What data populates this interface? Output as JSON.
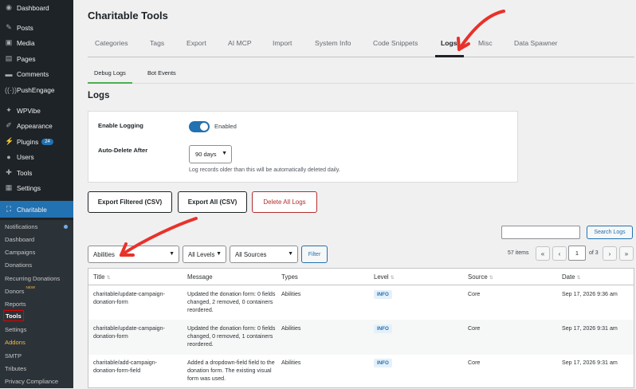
{
  "sidebar": {
    "menu": [
      {
        "label": "Dashboard",
        "icon": "dashboard-icon"
      },
      {
        "label": "Posts",
        "icon": "pin-icon"
      },
      {
        "label": "Media",
        "icon": "media-icon"
      },
      {
        "label": "Pages",
        "icon": "page-icon"
      },
      {
        "label": "Comments",
        "icon": "comment-icon"
      },
      {
        "label": "PushEngage",
        "icon": "broadcast-icon"
      },
      {
        "label": "WPVibe",
        "icon": "sparkle-icon"
      },
      {
        "label": "Appearance",
        "icon": "brush-icon"
      },
      {
        "label": "Plugins",
        "icon": "plug-icon",
        "badge": "24"
      },
      {
        "label": "Users",
        "icon": "user-icon"
      },
      {
        "label": "Tools",
        "icon": "wrench-icon"
      },
      {
        "label": "Settings",
        "icon": "settings-icon"
      },
      {
        "label": "Charitable",
        "icon": "charitable-icon"
      }
    ],
    "submenu": [
      {
        "label": "Notifications"
      },
      {
        "label": "Dashboard"
      },
      {
        "label": "Campaigns"
      },
      {
        "label": "Donations"
      },
      {
        "label": "Recurring Donations"
      },
      {
        "label": "Donors",
        "tag": "NEW!"
      },
      {
        "label": "Reports"
      },
      {
        "label": "Tools"
      },
      {
        "label": "Settings"
      },
      {
        "label": "Addons"
      },
      {
        "label": "SMTP"
      },
      {
        "label": "Tributes"
      },
      {
        "label": "Privacy Compliance"
      }
    ]
  },
  "page": {
    "title": "Charitable Tools",
    "tabs": [
      "Categories",
      "Tags",
      "Export",
      "AI MCP",
      "Import",
      "System Info",
      "Code Snippets",
      "Logs",
      "Misc",
      "Data Spawner"
    ],
    "subtabs": [
      "Debug Logs",
      "Bot Events"
    ],
    "section_title": "Logs"
  },
  "settings": {
    "enable_logging_label": "Enable Logging",
    "enabled_text": "Enabled",
    "logging_on": true,
    "auto_delete_label": "Auto-Delete After",
    "auto_delete_value": "90 days",
    "hint": "Log records older than this will be automatically deleted daily."
  },
  "actions": {
    "export_filtered": "Export Filtered (CSV)",
    "export_all": "Export All (CSV)",
    "delete_all": "Delete All Logs"
  },
  "search": {
    "button": "Search Logs",
    "value": ""
  },
  "filters": {
    "type": "Abilities",
    "level": "All Levels",
    "source": "All Sources",
    "button": "Filter"
  },
  "pagination": {
    "items": "57 items",
    "first": "«",
    "prev": "‹",
    "current": "1",
    "of": "of 3",
    "next": "›",
    "last": "»"
  },
  "table": {
    "columns": [
      "Title",
      "Message",
      "Types",
      "Level",
      "Source",
      "Date"
    ],
    "rows": [
      {
        "title": "charitable/update-campaign-donation-form",
        "message": "Updated the donation form: 0 fields changed, 2 removed, 0 containers reordered.",
        "type": "Abilities",
        "level": "INFO",
        "source": "Core",
        "date": "Sep 17, 2026 9:36 am"
      },
      {
        "title": "charitable/update-campaign-donation-form",
        "message": "Updated the donation form: 0 fields changed, 0 removed, 1 containers reordered.",
        "type": "Abilities",
        "level": "INFO",
        "source": "Core",
        "date": "Sep 17, 2026 9:31 am"
      },
      {
        "title": "charitable/add-campaign-donation-form-field",
        "message": "Added a dropdown-field field to the donation form. The existing visual form was used.",
        "type": "Abilities",
        "level": "INFO",
        "source": "Core",
        "date": "Sep 17, 2026 9:31 am"
      }
    ]
  },
  "colors": {
    "accent": "#2271b1",
    "sidebar": "#1d2327",
    "arrow": "#e8322a",
    "danger": "#b32d2e"
  }
}
